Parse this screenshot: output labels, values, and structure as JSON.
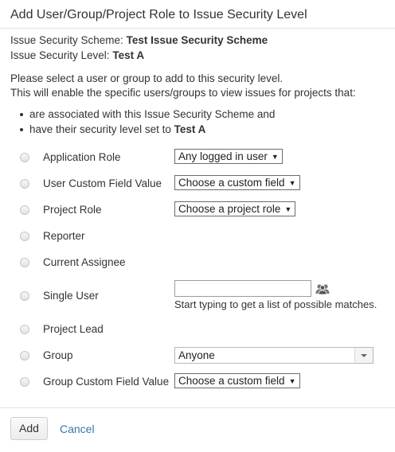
{
  "dialog": {
    "title": "Add User/Group/Project Role to Issue Security Level"
  },
  "info": {
    "scheme_label": "Issue Security Scheme:",
    "scheme_value": "Test Issue Security Scheme",
    "level_label": "Issue Security Level:",
    "level_value": "Test A"
  },
  "description": {
    "line1": "Please select a user or group to add to this security level.",
    "line2": "This will enable the specific users/groups to view issues for projects that:",
    "bullet1": "are associated with this Issue Security Scheme and",
    "bullet2_prefix": "have their security level set to",
    "bullet2_value": "Test A"
  },
  "options": {
    "application_role": {
      "label": "Application Role",
      "select": "Any logged in user"
    },
    "user_custom_field": {
      "label": "User Custom Field Value",
      "select": "Choose a custom field"
    },
    "project_role": {
      "label": "Project Role",
      "select": "Choose a project role"
    },
    "reporter": {
      "label": "Reporter"
    },
    "current_assignee": {
      "label": "Current Assignee"
    },
    "single_user": {
      "label": "Single User",
      "value": "",
      "hint": "Start typing to get a list of possible matches."
    },
    "project_lead": {
      "label": "Project Lead"
    },
    "group": {
      "label": "Group",
      "select": "Anyone"
    },
    "group_custom_field": {
      "label": "Group Custom Field Value",
      "select": "Choose a custom field"
    }
  },
  "footer": {
    "add_label": "Add",
    "cancel_label": "Cancel"
  },
  "icons": {
    "user_picker": "users-icon",
    "dropdown": "chevron-down-icon"
  },
  "colors": {
    "link": "#3b73af",
    "text": "#333333"
  }
}
